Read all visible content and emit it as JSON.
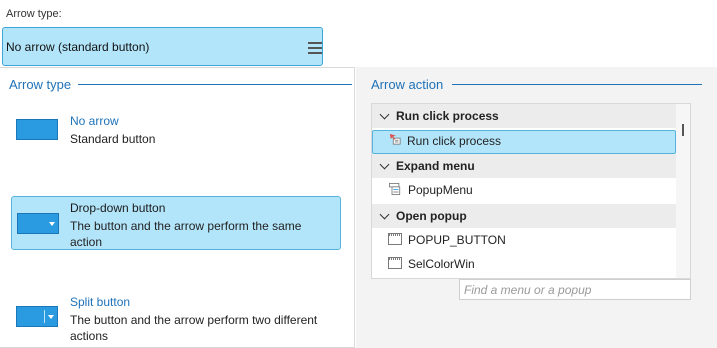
{
  "arrow_type_label": "Arrow type:",
  "combo": {
    "value": "No arrow (standard button)",
    "menu_icon": "hamburger-menu-icon"
  },
  "left_panel": {
    "title": "Arrow type",
    "options": [
      {
        "label": "No arrow",
        "description": "Standard button",
        "icon": "standard-button-icon",
        "selected": false
      },
      {
        "label": "Drop-down button",
        "description": "The button and the arrow perform the same action",
        "icon": "dropdown-button-icon",
        "selected": true
      },
      {
        "label": "Split button",
        "description": "The button and the arrow perform two different actions",
        "icon": "split-button-icon",
        "selected": false
      }
    ]
  },
  "right_panel": {
    "title": "Arrow action",
    "groups": [
      {
        "header": "Run click process",
        "items": [
          {
            "label": "Run click process",
            "icon": "click-process-icon",
            "selected": true
          }
        ]
      },
      {
        "header": "Expand menu",
        "items": [
          {
            "label": "PopupMenu",
            "icon": "popup-menu-icon",
            "selected": false
          }
        ]
      },
      {
        "header": "Open popup",
        "items": [
          {
            "label": "POPUP_BUTTON",
            "icon": "window-icon",
            "selected": false
          },
          {
            "label": "SelColorWin",
            "icon": "window-icon",
            "selected": false
          }
        ]
      }
    ],
    "search_placeholder": "Find a menu or a popup"
  },
  "colors": {
    "accent": "#1f72b8",
    "selection": "#b3e5fa",
    "button_blue": "#2a9be0"
  }
}
